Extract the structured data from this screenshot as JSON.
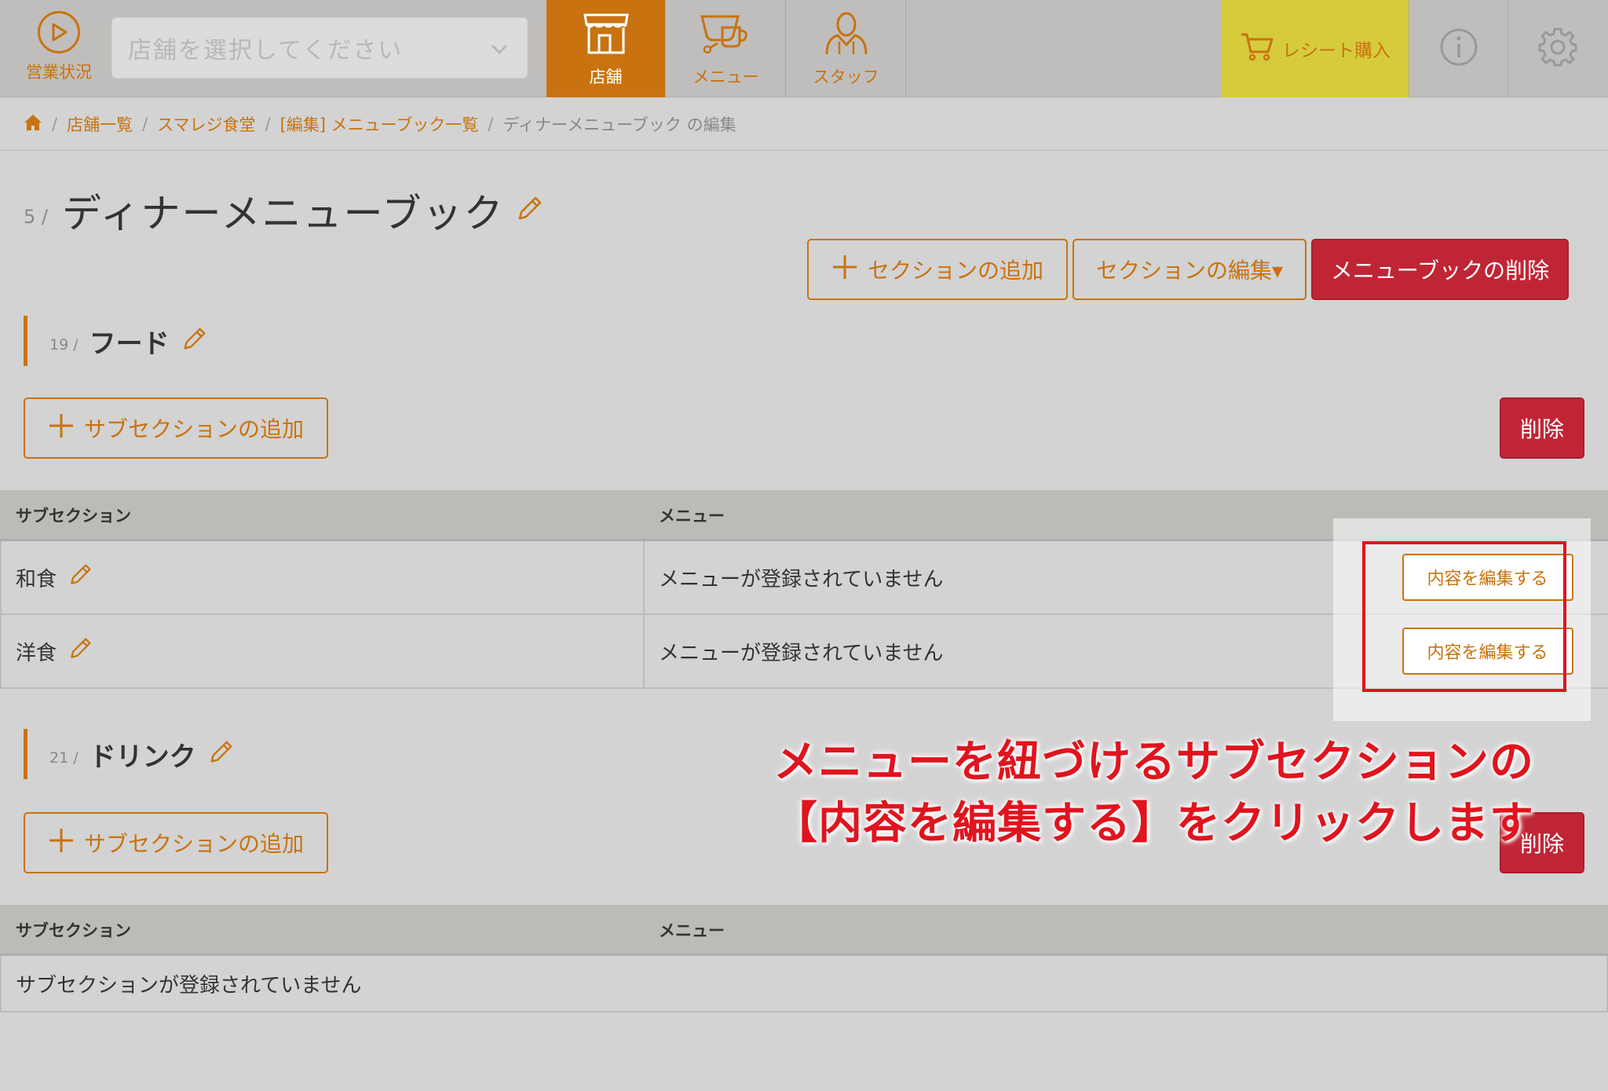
{
  "header": {
    "status_label": "営業状況",
    "store_select_placeholder": "店舗を選択してください",
    "tabs": [
      {
        "label": "店舗",
        "icon": "storefront-icon",
        "active": true
      },
      {
        "label": "メニュー",
        "icon": "coffee-cup-icon",
        "active": false
      },
      {
        "label": "スタッフ",
        "icon": "staff-person-icon",
        "active": false
      }
    ],
    "receipt_label": "レシート購入",
    "colors": {
      "accent": "#c8730f",
      "receipt_bg": "#d6cc3b",
      "danger": "#c02536"
    }
  },
  "breadcrumb": {
    "items": [
      "店舗一覧",
      "スマレジ食堂",
      "[編集] メニューブック一覧"
    ],
    "current": "ディナーメニューブック の編集"
  },
  "page": {
    "number": "5 /",
    "title": "ディナーメニューブック",
    "add_section_label": "セクションの追加",
    "edit_section_label": "セクションの編集▾",
    "delete_menubook_label": "メニューブックの削除"
  },
  "sections": [
    {
      "number": "19 /",
      "title": "フード",
      "add_subsection_label": "サブセクションの追加",
      "delete_label": "削除",
      "table": {
        "headers": [
          "サブセクション",
          "メニュー",
          ""
        ],
        "rows": [
          {
            "name": "和食",
            "menu": "メニューが登録されていません",
            "action": "内容を編集する"
          },
          {
            "name": "洋食",
            "menu": "メニューが登録されていません",
            "action": "内容を編集する"
          }
        ]
      }
    },
    {
      "number": "21 /",
      "title": "ドリンク",
      "add_subsection_label": "サブセクションの追加",
      "delete_label": "削除",
      "table": {
        "headers": [
          "サブセクション",
          "メニュー",
          ""
        ],
        "empty_message": "サブセクションが登録されていません"
      }
    }
  ],
  "annotation": {
    "text": "メニューを紐づけるサブセクションの\n【内容を編集する】をクリックします",
    "color": "#e0141e"
  }
}
